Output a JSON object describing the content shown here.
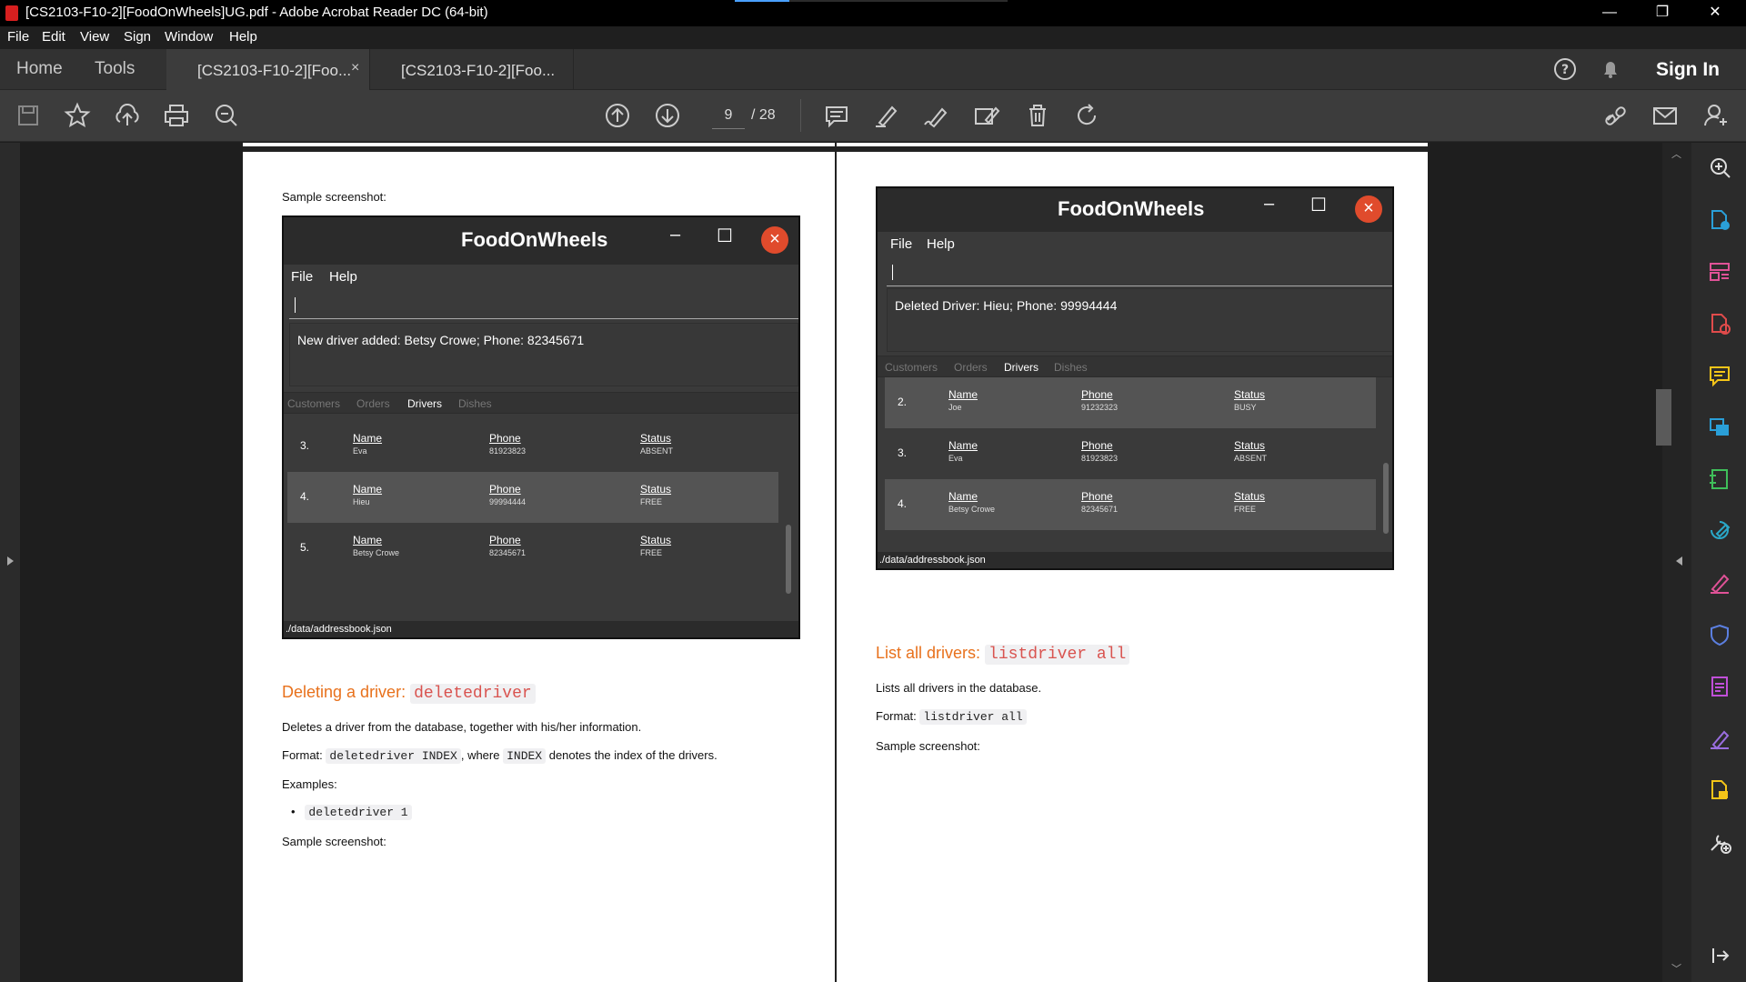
{
  "window": {
    "title": "[CS2103-F10-2][FoodOnWheels]UG.pdf - Adobe Acrobat Reader DC (64-bit)",
    "minimize": "—",
    "restore": "❐",
    "close": "✕"
  },
  "menu": [
    "File",
    "Edit",
    "View",
    "Sign",
    "Window",
    "Help"
  ],
  "tabs": {
    "home": "Home",
    "tools": "Tools",
    "doc1": "[CS2103-F10-2][Foo...",
    "doc2": "[CS2103-F10-2][Foo...",
    "close": "×",
    "sign_in": "Sign In"
  },
  "toolbar": {
    "page_current": "9",
    "page_total": "/ 28"
  },
  "left_page": {
    "sample_label_top": "Sample screenshot:",
    "app": {
      "title": "FoodOnWheels",
      "menu_file": "File",
      "menu_help": "Help",
      "result": "New driver added: Betsy Crowe; Phone: 82345671",
      "tabs": [
        "Customers",
        "Orders",
        "Drivers",
        "Dishes"
      ],
      "rows": [
        {
          "index": "3.",
          "name": "Eva",
          "phone": "81923823",
          "status": "ABSENT"
        },
        {
          "index": "4.",
          "name": "Hieu",
          "phone": "99994444",
          "status": "FREE"
        },
        {
          "index": "5.",
          "name": "Betsy Crowe",
          "phone": "82345671",
          "status": "FREE"
        }
      ],
      "col_name": "Name",
      "col_phone": "Phone",
      "col_status": "Status",
      "footer": "./data/addressbook.json"
    },
    "heading_text": "Deleting a driver: ",
    "heading_code": "deletedriver",
    "desc": "Deletes a driver from the database, together with his/her information.",
    "format_label": "Format: ",
    "format_code": "deletedriver INDEX",
    "format_mid": ", where ",
    "format_code2": "INDEX",
    "format_end": " denotes the index of the drivers.",
    "examples": "Examples:",
    "example1": "deletedriver 1",
    "sample_label": "Sample screenshot:"
  },
  "right_page": {
    "app": {
      "title": "FoodOnWheels",
      "menu_file": "File",
      "menu_help": "Help",
      "result": "Deleted Driver: Hieu; Phone: 99994444",
      "tabs": [
        "Customers",
        "Orders",
        "Drivers",
        "Dishes"
      ],
      "rows": [
        {
          "index": "2.",
          "name": "Joe",
          "phone": "91232323",
          "status": "BUSY"
        },
        {
          "index": "3.",
          "name": "Eva",
          "phone": "81923823",
          "status": "ABSENT"
        },
        {
          "index": "4.",
          "name": "Betsy Crowe",
          "phone": "82345671",
          "status": "FREE"
        }
      ],
      "col_name": "Name",
      "col_phone": "Phone",
      "col_status": "Status",
      "footer": "./data/addressbook.json"
    },
    "heading_text": "List all drivers: ",
    "heading_code": "listdriver all",
    "desc": "Lists all drivers in the database.",
    "format_label": "Format: ",
    "format_code": "listdriver all",
    "sample_label": "Sample screenshot:"
  },
  "colors": {
    "accent": "#e8711c",
    "close_red": "#e04b2c",
    "pdf_red": "#d61f1f"
  }
}
